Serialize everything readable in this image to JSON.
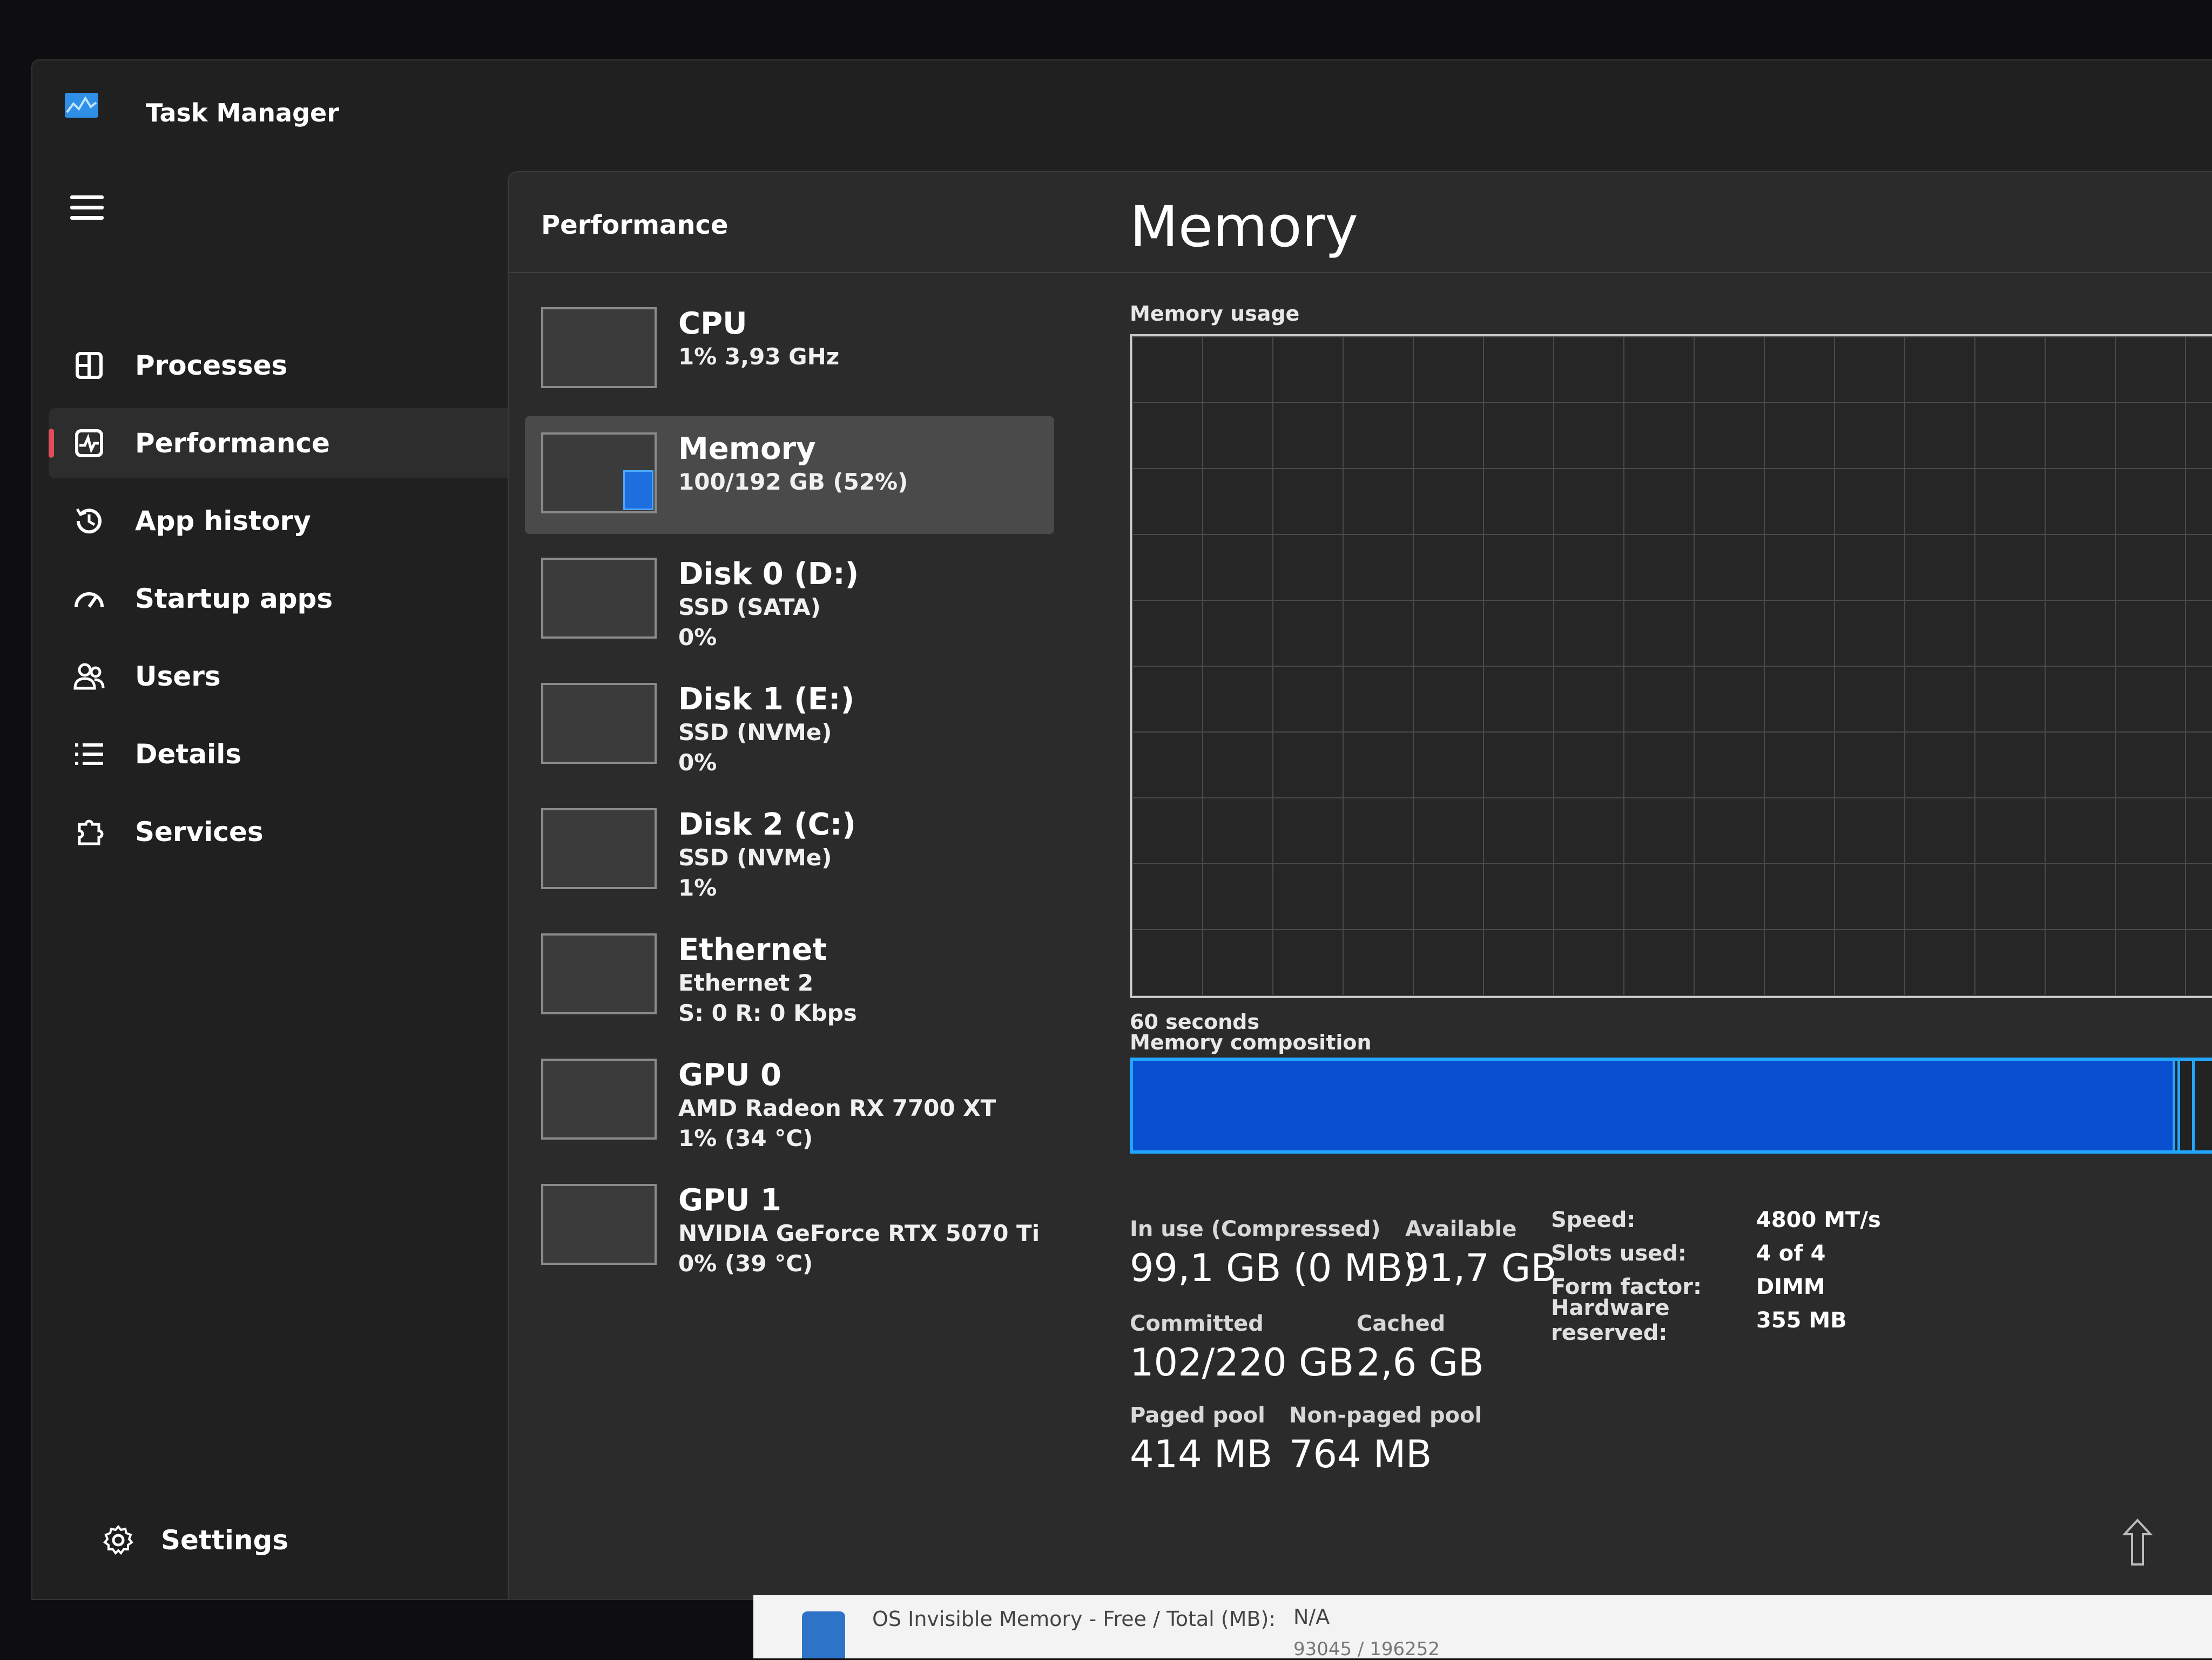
{
  "app": {
    "title": "Task Manager",
    "accent": "#e04d5a"
  },
  "nav": {
    "items": [
      {
        "label": "Processes",
        "icon": "processes-icon"
      },
      {
        "label": "Performance",
        "icon": "performance-icon"
      },
      {
        "label": "App history",
        "icon": "history-icon"
      },
      {
        "label": "Startup apps",
        "icon": "speedometer-icon"
      },
      {
        "label": "Users",
        "icon": "users-icon"
      },
      {
        "label": "Details",
        "icon": "list-icon"
      },
      {
        "label": "Services",
        "icon": "puzzle-icon"
      }
    ],
    "active": "Performance",
    "settings_label": "Settings"
  },
  "page": {
    "title": "Performance"
  },
  "devices": [
    {
      "name": "CPU",
      "line1": "1% 3,93 GHz",
      "line2": ""
    },
    {
      "name": "Memory",
      "line1": "100/192 GB (52%)",
      "line2": "",
      "selected": true,
      "usage_fraction": 0.52
    },
    {
      "name": "Disk 0 (D:)",
      "line1": "SSD (SATA)",
      "line2": "0%"
    },
    {
      "name": "Disk 1 (E:)",
      "line1": "SSD (NVMe)",
      "line2": "0%"
    },
    {
      "name": "Disk 2 (C:)",
      "line1": "SSD (NVMe)",
      "line2": "1%"
    },
    {
      "name": "Ethernet",
      "line1": "Ethernet 2",
      "line2": "S: 0 R: 0 Kbps"
    },
    {
      "name": "GPU 0",
      "line1": "AMD Radeon RX 7700 XT",
      "line2": "1% (34 °C)"
    },
    {
      "name": "GPU 1",
      "line1": "NVIDIA GeForce RTX 5070 Ti",
      "line2": "0% (39 °C)"
    }
  ],
  "detail": {
    "title": "Memory",
    "usage_label": "Memory usage",
    "time_label": "60 seconds",
    "composition_label": "Memory composition",
    "composition": {
      "in_use_fraction": 0.88,
      "colors": {
        "in_use": "#0a4fd0",
        "border": "#23a6ff"
      }
    },
    "stats": {
      "in_use": {
        "label": "In use (Compressed)",
        "value": "99,1 GB (0 MB)"
      },
      "available": {
        "label": "Available",
        "value": "91,7 GB"
      },
      "committed": {
        "label": "Committed",
        "value": "102/220 GB"
      },
      "cached": {
        "label": "Cached",
        "value": "2,6 GB"
      },
      "paged_pool": {
        "label": "Paged pool",
        "value": "414 MB"
      },
      "nonpaged_pool": {
        "label": "Non-paged pool",
        "value": "764 MB"
      }
    },
    "specs": [
      {
        "key": "Speed:",
        "value": "4800 MT/s"
      },
      {
        "key": "Slots used:",
        "value": "4 of 4"
      },
      {
        "key": "Form factor:",
        "value": "DIMM"
      },
      {
        "key": "Hardware reserved:",
        "value": "355 MB"
      }
    ]
  },
  "overlay": {
    "label": "OS Invisible Memory - Free / Total (MB):",
    "value": "N/A",
    "line2": "93045 / 196252"
  }
}
